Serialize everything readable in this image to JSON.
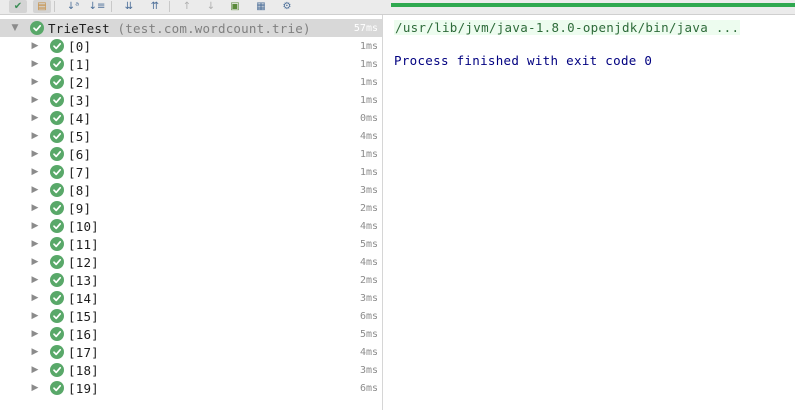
{
  "toolbar": {
    "buttons": [
      {
        "icon": "show-passed-icon",
        "glyph": "✔",
        "color": "#3d8f58",
        "active": true
      },
      {
        "icon": "show-ignored-icon",
        "glyph": "▤",
        "color": "#c58a3a",
        "active": true
      },
      {
        "icon": "sort-alphabetically-icon",
        "glyph": "↓ᵃ",
        "color": "#4d6f99"
      },
      {
        "icon": "sort-by-duration-icon",
        "glyph": "↓≡",
        "color": "#4d6f99"
      },
      {
        "icon": "expand-all-icon",
        "glyph": "⇊",
        "color": "#4d6f99"
      },
      {
        "icon": "collapse-all-icon",
        "glyph": "⇈",
        "color": "#4d6f99"
      },
      {
        "icon": "previous-failed-icon",
        "glyph": "↑",
        "color": "#b0b0b0"
      },
      {
        "icon": "next-failed-icon",
        "glyph": "↓",
        "color": "#b0b0b0"
      },
      {
        "icon": "export-results-icon",
        "glyph": "▣",
        "color": "#5a8a3a"
      },
      {
        "icon": "import-results-icon",
        "glyph": "▦",
        "color": "#4d6f99"
      },
      {
        "icon": "settings-icon",
        "glyph": "⚙",
        "color": "#4d6f99"
      }
    ],
    "progress_color": "#2fa84f",
    "progress_fraction": 1.0
  },
  "tree": {
    "root": {
      "name": "TrieTest",
      "package": "(test.com.wordcount.trie)",
      "time": "57ms"
    },
    "items": [
      {
        "name": "[0]",
        "time": "1ms"
      },
      {
        "name": "[1]",
        "time": "1ms"
      },
      {
        "name": "[2]",
        "time": "1ms"
      },
      {
        "name": "[3]",
        "time": "1ms"
      },
      {
        "name": "[4]",
        "time": "0ms"
      },
      {
        "name": "[5]",
        "time": "4ms"
      },
      {
        "name": "[6]",
        "time": "1ms"
      },
      {
        "name": "[7]",
        "time": "1ms"
      },
      {
        "name": "[8]",
        "time": "3ms"
      },
      {
        "name": "[9]",
        "time": "2ms"
      },
      {
        "name": "[10]",
        "time": "4ms"
      },
      {
        "name": "[11]",
        "time": "5ms"
      },
      {
        "name": "[12]",
        "time": "4ms"
      },
      {
        "name": "[13]",
        "time": "2ms"
      },
      {
        "name": "[14]",
        "time": "3ms"
      },
      {
        "name": "[15]",
        "time": "6ms"
      },
      {
        "name": "[16]",
        "time": "5ms"
      },
      {
        "name": "[17]",
        "time": "4ms"
      },
      {
        "name": "[18]",
        "time": "3ms"
      },
      {
        "name": "[19]",
        "time": "6ms"
      }
    ],
    "status_icon": "passed-check-icon",
    "status_color": "#59a869"
  },
  "console": {
    "command": "/usr/lib/jvm/java-1.8.0-openjdk/bin/java ...",
    "exit_message": "Process finished with exit code 0"
  }
}
